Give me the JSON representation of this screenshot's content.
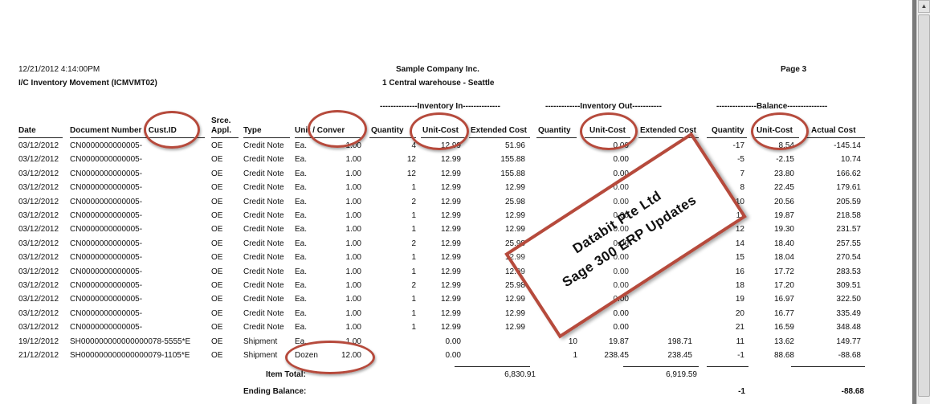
{
  "header": {
    "datetime": "12/21/2012   4:14:00PM",
    "report_name": "I/C Inventory Movement (ICMVMT02)",
    "company": "Sample Company Inc.",
    "location": "1  Central warehouse - Seattle",
    "page": "Page 3"
  },
  "groups": {
    "inventory_in": "--------------Inventory In--------------",
    "inventory_out": "-------------Inventory Out-----------",
    "balance": "---------------Balance---------------"
  },
  "columns": {
    "date": "Date",
    "doc_number": "Document Number / Cust.ID",
    "srce_appl_1": "Srce.",
    "srce_appl_2": "Appl.",
    "type": "Type",
    "unit_conver": "Unit / Conver",
    "in_quantity": "Quantity",
    "in_unit_cost": "Unit-Cost",
    "in_extended_cost": "Extended Cost",
    "out_quantity": "Quantity",
    "out_unit_cost": "Unit-Cost",
    "out_extended_cost": "Extended Cost",
    "bal_quantity": "Quantity",
    "bal_unit_cost": "Unit-Cost",
    "bal_actual_cost": "Actual Cost"
  },
  "rows": [
    {
      "date": "03/12/2012",
      "doc": "CN0000000000005-",
      "appl": "OE",
      "type": "Credit Note",
      "unit": "Ea.",
      "conv": "1.00",
      "in_qty": "4",
      "in_uc": "12.99",
      "in_ext": "51.96",
      "out_qty": "",
      "out_uc": "0.00",
      "out_ext": "",
      "bal_qty": "-17",
      "bal_uc": "8.54",
      "bal_cost": "-145.14"
    },
    {
      "date": "03/12/2012",
      "doc": "CN0000000000005-",
      "appl": "OE",
      "type": "Credit Note",
      "unit": "Ea.",
      "conv": "1.00",
      "in_qty": "12",
      "in_uc": "12.99",
      "in_ext": "155.88",
      "out_qty": "",
      "out_uc": "0.00",
      "out_ext": "",
      "bal_qty": "-5",
      "bal_uc": "-2.15",
      "bal_cost": "10.74"
    },
    {
      "date": "03/12/2012",
      "doc": "CN0000000000005-",
      "appl": "OE",
      "type": "Credit Note",
      "unit": "Ea.",
      "conv": "1.00",
      "in_qty": "12",
      "in_uc": "12.99",
      "in_ext": "155.88",
      "out_qty": "",
      "out_uc": "0.00",
      "out_ext": "",
      "bal_qty": "7",
      "bal_uc": "23.80",
      "bal_cost": "166.62"
    },
    {
      "date": "03/12/2012",
      "doc": "CN0000000000005-",
      "appl": "OE",
      "type": "Credit Note",
      "unit": "Ea.",
      "conv": "1.00",
      "in_qty": "1",
      "in_uc": "12.99",
      "in_ext": "12.99",
      "out_qty": "",
      "out_uc": "0.00",
      "out_ext": "",
      "bal_qty": "8",
      "bal_uc": "22.45",
      "bal_cost": "179.61"
    },
    {
      "date": "03/12/2012",
      "doc": "CN0000000000005-",
      "appl": "OE",
      "type": "Credit Note",
      "unit": "Ea.",
      "conv": "1.00",
      "in_qty": "2",
      "in_uc": "12.99",
      "in_ext": "25.98",
      "out_qty": "",
      "out_uc": "0.00",
      "out_ext": "",
      "bal_qty": "10",
      "bal_uc": "20.56",
      "bal_cost": "205.59"
    },
    {
      "date": "03/12/2012",
      "doc": "CN0000000000005-",
      "appl": "OE",
      "type": "Credit Note",
      "unit": "Ea.",
      "conv": "1.00",
      "in_qty": "1",
      "in_uc": "12.99",
      "in_ext": "12.99",
      "out_qty": "",
      "out_uc": "0.00",
      "out_ext": "",
      "bal_qty": "11",
      "bal_uc": "19.87",
      "bal_cost": "218.58"
    },
    {
      "date": "03/12/2012",
      "doc": "CN0000000000005-",
      "appl": "OE",
      "type": "Credit Note",
      "unit": "Ea.",
      "conv": "1.00",
      "in_qty": "1",
      "in_uc": "12.99",
      "in_ext": "12.99",
      "out_qty": "",
      "out_uc": "0.00",
      "out_ext": "",
      "bal_qty": "12",
      "bal_uc": "19.30",
      "bal_cost": "231.57"
    },
    {
      "date": "03/12/2012",
      "doc": "CN0000000000005-",
      "appl": "OE",
      "type": "Credit Note",
      "unit": "Ea.",
      "conv": "1.00",
      "in_qty": "2",
      "in_uc": "12.99",
      "in_ext": "25.98",
      "out_qty": "",
      "out_uc": "0.00",
      "out_ext": "",
      "bal_qty": "14",
      "bal_uc": "18.40",
      "bal_cost": "257.55"
    },
    {
      "date": "03/12/2012",
      "doc": "CN0000000000005-",
      "appl": "OE",
      "type": "Credit Note",
      "unit": "Ea.",
      "conv": "1.00",
      "in_qty": "1",
      "in_uc": "12.99",
      "in_ext": "12.99",
      "out_qty": "",
      "out_uc": "0.00",
      "out_ext": "",
      "bal_qty": "15",
      "bal_uc": "18.04",
      "bal_cost": "270.54"
    },
    {
      "date": "03/12/2012",
      "doc": "CN0000000000005-",
      "appl": "OE",
      "type": "Credit Note",
      "unit": "Ea.",
      "conv": "1.00",
      "in_qty": "1",
      "in_uc": "12.99",
      "in_ext": "12.99",
      "out_qty": "",
      "out_uc": "0.00",
      "out_ext": "",
      "bal_qty": "16",
      "bal_uc": "17.72",
      "bal_cost": "283.53"
    },
    {
      "date": "03/12/2012",
      "doc": "CN0000000000005-",
      "appl": "OE",
      "type": "Credit Note",
      "unit": "Ea.",
      "conv": "1.00",
      "in_qty": "2",
      "in_uc": "12.99",
      "in_ext": "25.98",
      "out_qty": "",
      "out_uc": "0.00",
      "out_ext": "",
      "bal_qty": "18",
      "bal_uc": "17.20",
      "bal_cost": "309.51"
    },
    {
      "date": "03/12/2012",
      "doc": "CN0000000000005-",
      "appl": "OE",
      "type": "Credit Note",
      "unit": "Ea.",
      "conv": "1.00",
      "in_qty": "1",
      "in_uc": "12.99",
      "in_ext": "12.99",
      "out_qty": "",
      "out_uc": "0.00",
      "out_ext": "",
      "bal_qty": "19",
      "bal_uc": "16.97",
      "bal_cost": "322.50"
    },
    {
      "date": "03/12/2012",
      "doc": "CN0000000000005-",
      "appl": "OE",
      "type": "Credit Note",
      "unit": "Ea.",
      "conv": "1.00",
      "in_qty": "1",
      "in_uc": "12.99",
      "in_ext": "12.99",
      "out_qty": "",
      "out_uc": "0.00",
      "out_ext": "",
      "bal_qty": "20",
      "bal_uc": "16.77",
      "bal_cost": "335.49"
    },
    {
      "date": "03/12/2012",
      "doc": "CN0000000000005-",
      "appl": "OE",
      "type": "Credit Note",
      "unit": "Ea.",
      "conv": "1.00",
      "in_qty": "1",
      "in_uc": "12.99",
      "in_ext": "12.99",
      "out_qty": "",
      "out_uc": "0.00",
      "out_ext": "",
      "bal_qty": "21",
      "bal_uc": "16.59",
      "bal_cost": "348.48"
    },
    {
      "date": "19/12/2012",
      "doc": "SH000000000000000078-5555*E",
      "appl": "OE",
      "type": "Shipment",
      "unit": "Ea.",
      "conv": "1.00",
      "in_qty": "",
      "in_uc": "0.00",
      "in_ext": "",
      "out_qty": "10",
      "out_uc": "19.87",
      "out_ext": "198.71",
      "bal_qty": "11",
      "bal_uc": "13.62",
      "bal_cost": "149.77"
    },
    {
      "date": "21/12/2012",
      "doc": "SH000000000000000079-1105*E",
      "appl": "OE",
      "type": "Shipment",
      "unit": "Dozen",
      "conv": "12.00",
      "in_qty": "",
      "in_uc": "0.00",
      "in_ext": "",
      "out_qty": "1",
      "out_uc": "238.45",
      "out_ext": "238.45",
      "bal_qty": "-1",
      "bal_uc": "88.68",
      "bal_cost": "-88.68"
    }
  ],
  "totals": {
    "item_total_label": "Item Total:",
    "in_extended_total": "6,830.91",
    "out_extended_total": "6,919.59",
    "ending_balance_label": "Ending Balance:",
    "ending_qty": "-1",
    "ending_cost": "-88.68"
  },
  "watermark": {
    "line1": "Databit Pte Ltd",
    "line2": "Sage 300 ERP Updates",
    "color": "#b64a3c"
  }
}
